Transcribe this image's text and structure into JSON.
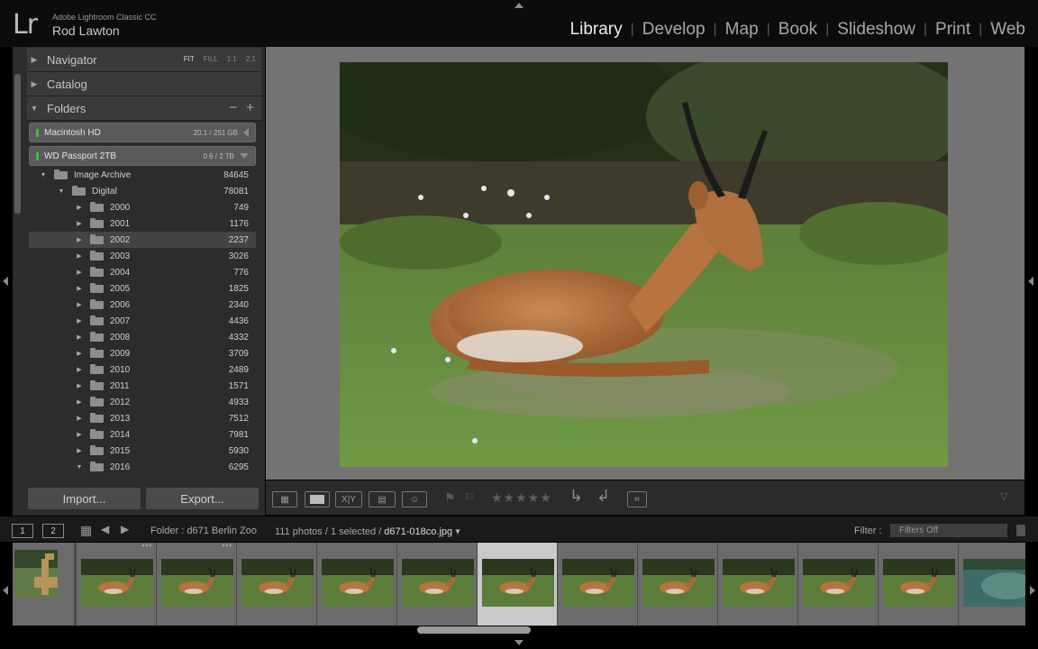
{
  "app": {
    "logo": "Lr",
    "product": "Adobe Lightroom Classic CC",
    "user": "Rod Lawton"
  },
  "modules": [
    {
      "label": "Library",
      "active": true
    },
    {
      "label": "Develop",
      "active": false
    },
    {
      "label": "Map",
      "active": false
    },
    {
      "label": "Book",
      "active": false
    },
    {
      "label": "Slideshow",
      "active": false
    },
    {
      "label": "Print",
      "active": false
    },
    {
      "label": "Web",
      "active": false
    }
  ],
  "left_panel": {
    "navigator": {
      "label": "Navigator",
      "zoom_options": [
        "FIT",
        "FILL",
        "1:1",
        "2:1"
      ],
      "zoom_selected": "FIT"
    },
    "catalog": {
      "label": "Catalog"
    },
    "folders": {
      "label": "Folders",
      "volumes": [
        {
          "name": "Macintosh HD",
          "capacity": "20.1 / 251 GB"
        },
        {
          "name": "WD Passport 2TB",
          "capacity": "0.6 / 2 TB"
        }
      ],
      "tree": [
        {
          "name": "Image Archive",
          "count": "84645",
          "level": 0,
          "expanded": true
        },
        {
          "name": "Digital",
          "count": "78081",
          "level": 1,
          "expanded": true
        },
        {
          "name": "2000",
          "count": "749",
          "level": 2
        },
        {
          "name": "2001",
          "count": "1176",
          "level": 2
        },
        {
          "name": "2002",
          "count": "2237",
          "level": 2,
          "selected": true
        },
        {
          "name": "2003",
          "count": "3026",
          "level": 2
        },
        {
          "name": "2004",
          "count": "776",
          "level": 2
        },
        {
          "name": "2005",
          "count": "1825",
          "level": 2
        },
        {
          "name": "2006",
          "count": "2340",
          "level": 2
        },
        {
          "name": "2007",
          "count": "4436",
          "level": 2
        },
        {
          "name": "2008",
          "count": "4332",
          "level": 2
        },
        {
          "name": "2009",
          "count": "3709",
          "level": 2
        },
        {
          "name": "2010",
          "count": "2489",
          "level": 2
        },
        {
          "name": "2011",
          "count": "1571",
          "level": 2
        },
        {
          "name": "2012",
          "count": "4933",
          "level": 2
        },
        {
          "name": "2013",
          "count": "7512",
          "level": 2
        },
        {
          "name": "2014",
          "count": "7981",
          "level": 2
        },
        {
          "name": "2015",
          "count": "5930",
          "level": 2
        },
        {
          "name": "2016",
          "count": "6295",
          "level": 2,
          "expanded": true
        }
      ]
    },
    "import_label": "Import...",
    "export_label": "Export..."
  },
  "toolbar": {
    "compare_label": "X|Y",
    "stars": "★★★★★"
  },
  "filmstrip_bar": {
    "monitor1": "1",
    "monitor2": "2",
    "folder": "Folder : d671 Berlin Zoo",
    "count_prefix": "111 photos / 1 selected /",
    "filename": "d671-018co.jpg",
    "filter_label": "Filter :",
    "filter_value": "Filters Off"
  },
  "filmstrip": {
    "selected_index": 6,
    "dots": "°°°"
  },
  "colors": {
    "accent": "#ececec",
    "panel": "#2c2c2c",
    "background": "#737373",
    "volume_led": "#3fbf3f"
  }
}
